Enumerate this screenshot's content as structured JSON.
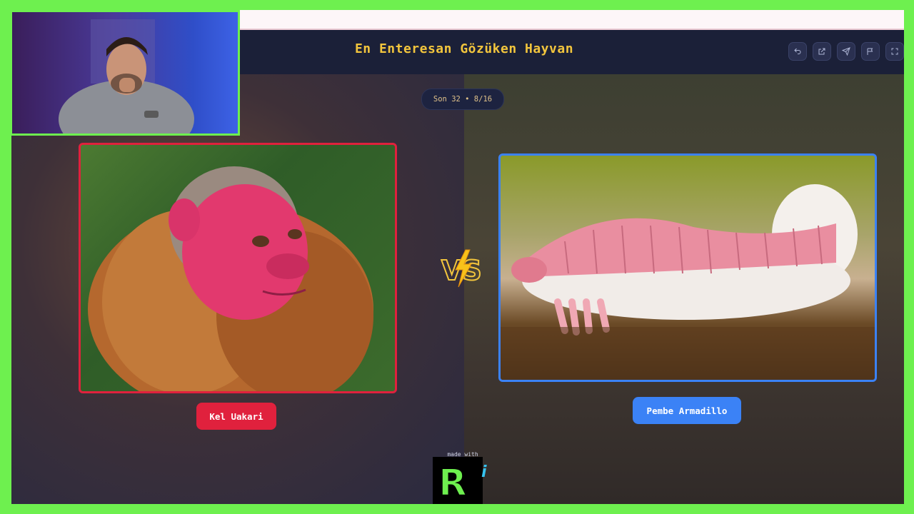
{
  "page": {
    "title": "En Enteresan Gözüken Hayvan"
  },
  "header_buttons": [
    {
      "icon": "undo-icon"
    },
    {
      "icon": "share-icon"
    },
    {
      "icon": "send-icon"
    },
    {
      "icon": "flag-icon"
    },
    {
      "icon": "fullscreen-icon"
    }
  ],
  "round": {
    "badge": "Son 32 • 8/16"
  },
  "left": {
    "name": "Kel Uakari",
    "accent": "#e0213d",
    "image_icon": "bald-uakari-photo"
  },
  "right": {
    "name": "Pembe Armadillo",
    "accent": "#3b82f6",
    "image_icon": "pink-fairy-armadillo-photo"
  },
  "vs": {
    "icon": "vs-lightning-icon",
    "accent": "#f2c53d"
  },
  "watermark": {
    "caption": "made with",
    "letter": "R",
    "suffix": "i"
  },
  "colors": {
    "frame_border": "#6ef04f",
    "title": "#f2c53d",
    "background": "#1d2338"
  }
}
